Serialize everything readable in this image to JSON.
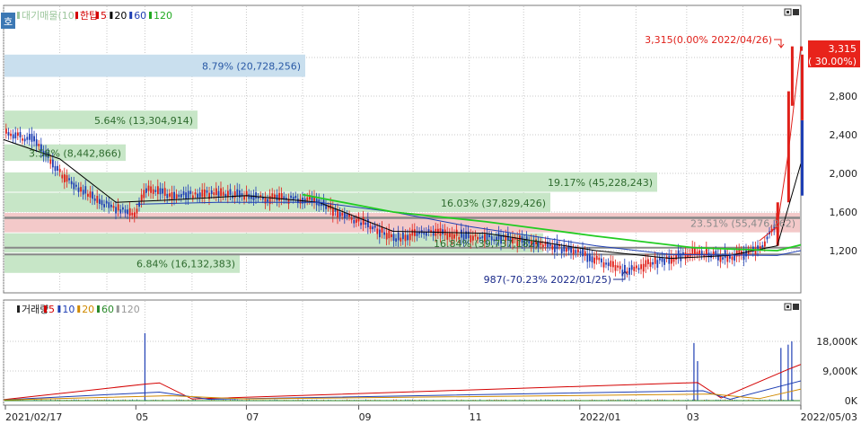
{
  "toolbar": {
    "mode_button_label": "호",
    "price_legend": [
      {
        "label": "대기매물(10)",
        "color": "#9ec79e"
      },
      {
        "label": "한탑",
        "color": "#d40000"
      },
      {
        "label": "5",
        "color": "#d40000"
      },
      {
        "label": "20",
        "color": "#000000"
      },
      {
        "label": "60",
        "color": "#1f3fb4"
      },
      {
        "label": "120",
        "color": "#22aa22"
      }
    ],
    "volume_legend": [
      {
        "label": "거래량",
        "color": "#222222"
      },
      {
        "label": "5",
        "color": "#d40000"
      },
      {
        "label": "10",
        "color": "#1f3fb4"
      },
      {
        "label": "20",
        "color": "#d08a00"
      },
      {
        "label": "60",
        "color": "#2a8a2a"
      },
      {
        "label": "120",
        "color": "#999999"
      }
    ]
  },
  "price_axis": {
    "ticks": [
      "1,200",
      "1,600",
      "2,000",
      "2,400",
      "2,800"
    ],
    "current_price": "3,315",
    "current_change": "( 30.00%)"
  },
  "volume_axis": {
    "ticks": [
      "0K",
      "9,000K",
      "18,000K"
    ]
  },
  "date_axis": {
    "ticks": [
      "2021/02/17",
      "05",
      "07",
      "09",
      "11",
      "2022/01",
      "03",
      "2022/05/03"
    ]
  },
  "annotations": {
    "high": "3,315(0.00% 2022/04/26)",
    "low": "987(-70.23% 2022/01/25)"
  },
  "chart_data": {
    "type": "line",
    "title": "한탑",
    "x_range": [
      "2021/02/17",
      "2022/05/03"
    ],
    "ylim": [
      1000,
      3500
    ],
    "volume_ylim": [
      0,
      22000
    ],
    "volume_unit": "K",
    "grid": true,
    "supply_zones": [
      {
        "label": "8.79% (20,728,256)",
        "low": 2990,
        "high": 3230,
        "highlight": "blue"
      },
      {
        "label": "5.64% (13,304,914)",
        "low": 2450,
        "high": 2650,
        "highlight": "green"
      },
      {
        "label": "3.58% (8,442,866)",
        "low": 2120,
        "high": 2300,
        "highlight": "green"
      },
      {
        "label": "19.17% (45,228,243)",
        "low": 1800,
        "high": 2010,
        "highlight": "green"
      },
      {
        "label": "16.03% (37,829,426)",
        "low": 1590,
        "high": 1800,
        "highlight": "green"
      },
      {
        "label": "23.51% (55,476,262)",
        "low": 1380,
        "high": 1590,
        "highlight": "red"
      },
      {
        "label": "16.84% (39,737,182)",
        "low": 1170,
        "high": 1380,
        "highlight": "green"
      },
      {
        "label": "6.84% (16,132,383)",
        "low": 960,
        "high": 1170,
        "highlight": "green"
      }
    ],
    "horizontal_lines": [
      1540,
      1230,
      1160
    ],
    "series": [
      {
        "name": "한탑",
        "x": [
          "2021/02/17",
          "2021/03/05",
          "2021/03/20",
          "2021/04/10",
          "2021/04/30",
          "2021/05/06",
          "2021/05/20",
          "2021/06/15",
          "2021/07/10",
          "2021/08/05",
          "2021/08/25",
          "2021/09/20",
          "2021/10/10",
          "2021/11/01",
          "2021/11/20",
          "2021/12/10",
          "2022/01/05",
          "2022/01/25",
          "2022/02/15",
          "2022/03/05",
          "2022/03/25",
          "2022/04/12",
          "2022/04/20",
          "2022/04/26",
          "2022/05/03"
        ],
        "values": [
          2420,
          2350,
          2000,
          1700,
          1580,
          1850,
          1760,
          1800,
          1740,
          1730,
          1560,
          1330,
          1390,
          1340,
          1330,
          1280,
          1150,
          987,
          1100,
          1180,
          1130,
          1230,
          1550,
          3315,
          3315
        ]
      },
      {
        "name": "20",
        "x": [
          "2021/02/17",
          "2021/03/20",
          "2021/04/20",
          "2021/05/15",
          "2021/07/01",
          "2021/08/10",
          "2021/09/20",
          "2021/11/10",
          "2022/01/10",
          "2022/02/20",
          "2022/03/25",
          "2022/04/20",
          "2022/05/03"
        ],
        "values": [
          2350,
          2150,
          1700,
          1720,
          1770,
          1700,
          1400,
          1380,
          1200,
          1120,
          1150,
          1250,
          2100
        ]
      },
      {
        "name": "60",
        "x": [
          "2021/05/01",
          "2021/06/15",
          "2021/08/10",
          "2021/09/20",
          "2021/11/01",
          "2022/01/10",
          "2022/02/20",
          "2022/04/20",
          "2022/05/03"
        ],
        "values": [
          1680,
          1700,
          1700,
          1600,
          1450,
          1250,
          1160,
          1150,
          1200
        ]
      },
      {
        "name": "120",
        "x": [
          "2021/08/01",
          "2021/09/20",
          "2021/11/10",
          "2022/01/10",
          "2022/03/05",
          "2022/04/20",
          "2022/05/03"
        ],
        "values": [
          1780,
          1600,
          1500,
          1350,
          1230,
          1200,
          1260
        ]
      }
    ],
    "volume_series": [
      {
        "name": "거래량",
        "x": [
          "2021/05/06",
          "2022/03/05",
          "2022/03/07",
          "2022/04/22",
          "2022/04/26",
          "2022/04/28"
        ],
        "values": [
          20500,
          17500,
          12000,
          16000,
          17000,
          18000
        ]
      },
      {
        "name": "5",
        "x": [
          "2021/02/17",
          "2021/05/06",
          "2021/05/14",
          "2021/06/01",
          "2022/03/07",
          "2022/03/20",
          "2022/04/26",
          "2022/05/03"
        ],
        "values": [
          300,
          5000,
          5400,
          500,
          5500,
          800,
          9500,
          11000
        ]
      },
      {
        "name": "10",
        "x": [
          "2021/02/17",
          "2021/05/14",
          "2021/06/10",
          "2022/03/10",
          "2022/03/25",
          "2022/05/03"
        ],
        "values": [
          250,
          2600,
          400,
          3000,
          400,
          6000
        ]
      },
      {
        "name": "20",
        "x": [
          "2021/02/17",
          "2021/05/20",
          "2021/07/01",
          "2022/03/15",
          "2022/04/10",
          "2022/05/03"
        ],
        "values": [
          200,
          1500,
          500,
          2000,
          600,
          3500
        ]
      }
    ]
  }
}
